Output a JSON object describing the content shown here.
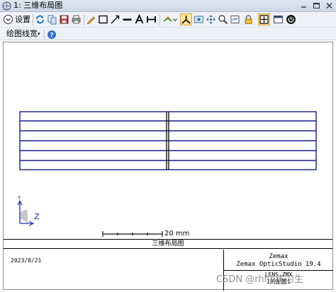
{
  "window": {
    "title": "1: 三维布局图",
    "icon": "layout-icon"
  },
  "toolbar": {
    "settings_label": "设置",
    "settings_icon": "chevron-circle-icon",
    "buttons": [
      "refresh-icon",
      "copy-icon",
      "save-icon",
      "export-icon",
      "print-icon",
      "pencil-icon",
      "rectangle-icon",
      "arrow-icon",
      "line-icon",
      "text-icon",
      "dimension-icon",
      "ray-icon",
      "rotate-axes-icon",
      "view-icon",
      "pan-icon",
      "zoom-icon",
      "clipboard-icon",
      "lock-icon",
      "fit-icon",
      "window-icon",
      "power-icon"
    ],
    "draw_width_label": "绘图线宽",
    "help_icon": "help-icon"
  },
  "plot": {
    "scale_bar_label": "20 mm",
    "axis_z_label": "Z",
    "lens_color": "#1a1a8c",
    "axis_color": "#1c2fb0"
  },
  "title_block": {
    "title": "三维布局图",
    "date": "2023/8/21",
    "company": "Zemax",
    "software": "Zemax OpticStudio 19.4",
    "file": "LENS.ZMX",
    "config": "1的配置1"
  },
  "watermark": "CSDN @rhhb练习生"
}
